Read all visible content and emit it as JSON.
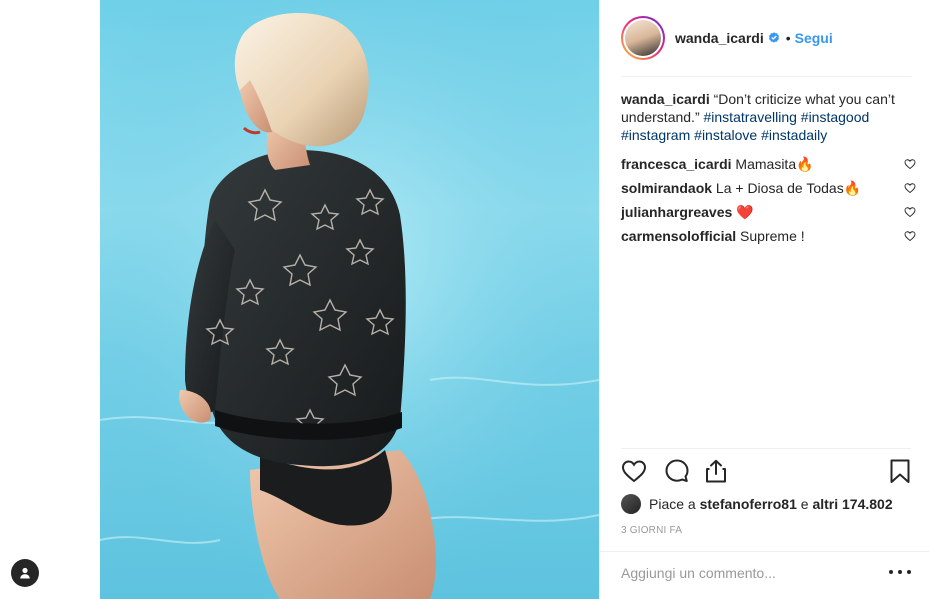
{
  "post": {
    "author": "wanda_icardi",
    "follow_label": "Segui",
    "dot": "•",
    "caption_text": "“Don’t criticize what you can’t understand.”",
    "hashtags": [
      "#instatravelling",
      "#instagood",
      "#instagram",
      "#instalove",
      "#instadaily"
    ]
  },
  "comments": [
    {
      "user": "francesca_icardi",
      "text": "Mamasita🔥"
    },
    {
      "user": "solmirandaok",
      "text": "La + Diosa de Todas🔥"
    },
    {
      "user": "julianhargreaves",
      "text": "❤️"
    },
    {
      "user": "carmensolofficial",
      "text": "Supreme !"
    }
  ],
  "likes": {
    "prefix": "Piace a",
    "user": "stefanoferro81",
    "connector": "e",
    "count": "altri 174.802"
  },
  "time": "3 GIORNI FA",
  "comment_input": {
    "placeholder": "Aggiungi un commento..."
  },
  "colors": {
    "link": "#3897f0",
    "hashtag": "#003569",
    "pool": "#6fd0e8"
  },
  "icons": [
    "user-icon",
    "verified-icon",
    "heart-icon",
    "comment-icon",
    "share-icon",
    "bookmark-icon",
    "more-icon"
  ]
}
